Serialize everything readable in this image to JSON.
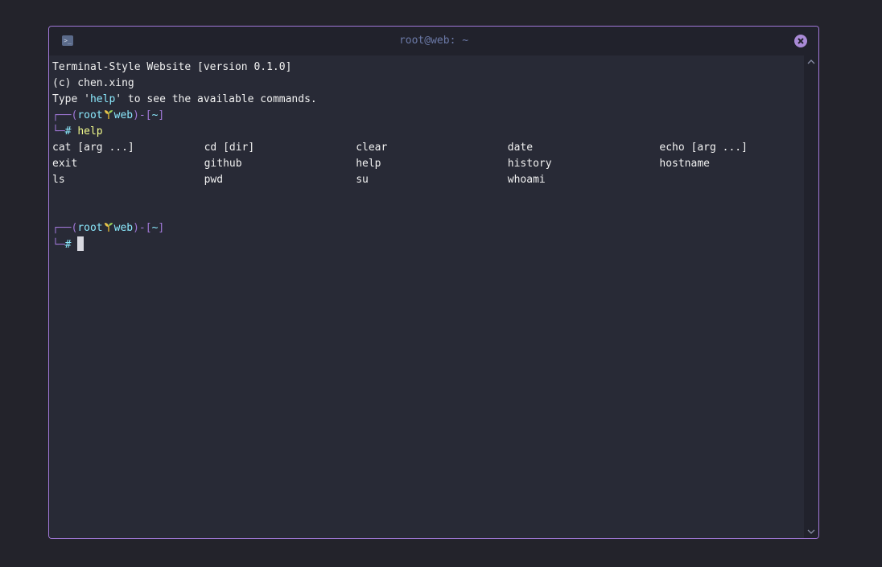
{
  "window": {
    "title": "root@web: ~",
    "border_color": "#a178d8"
  },
  "terminal": {
    "banner": [
      "Terminal-Style Website [version 0.1.0]",
      "(c) chen.xing"
    ],
    "help_hint": {
      "before": "Type '",
      "keyword": "help",
      "after": "' to see the available commands."
    },
    "prompt": {
      "top_open": "┌──(",
      "user": "root",
      "host": "web",
      "mid": ")-[",
      "dir": "~",
      "close": "]",
      "bottom": "└─",
      "hash": "#"
    },
    "last_command": "help",
    "help_output": [
      "cat [arg ...]",
      "cd [dir]",
      "clear",
      "date",
      "echo [arg ...]",
      "exit",
      "github",
      "help",
      "history",
      "hostname",
      "ls",
      "pwd",
      "su",
      "whoami"
    ]
  },
  "icons": {
    "terminal": "terminal-icon",
    "close": "close-icon",
    "separator": "plant-icon"
  },
  "colors": {
    "background": "#282a36",
    "accent": "#a178d8",
    "cyan": "#8be9fd",
    "yellow": "#f1fa8c"
  }
}
